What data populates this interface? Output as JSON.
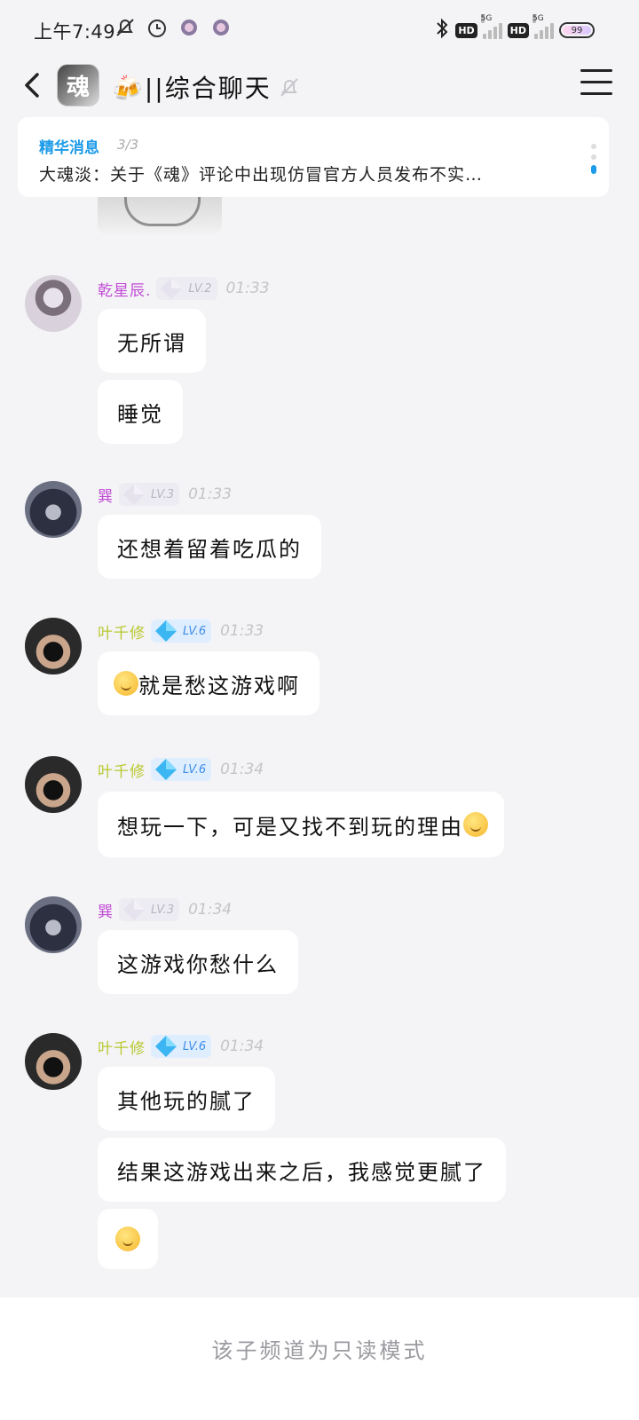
{
  "status_bar": {
    "time": "上午7:49",
    "network_type_1": "HD",
    "network_gen_1": "5G",
    "network_type_2": "HD",
    "network_gen_2": "5G",
    "battery": "99"
  },
  "header": {
    "channel_avatar_text": "魂",
    "title": "🍻||综合聊天"
  },
  "essence": {
    "label": "精华消息",
    "count": "3/3",
    "text": "大魂淡：关于《魂》评论中出现仿冒官方人员发布不实…"
  },
  "messages": [
    {
      "user": "乾星辰.",
      "level": "LV.2",
      "time": "01:33",
      "name_color": "#c14bd6",
      "bubbles": [
        "无所谓",
        "睡觉"
      ]
    },
    {
      "user": "巽",
      "level": "LV.3",
      "time": "01:33",
      "name_color": "#c14bd6",
      "bubbles": [
        "还想着留着吃瓜的"
      ]
    },
    {
      "user": "叶千修",
      "level": "LV.6",
      "time": "01:33",
      "name_color": "#b9c930",
      "bubbles": [
        "就是愁这游戏啊"
      ]
    },
    {
      "user": "叶千修",
      "level": "LV.6",
      "time": "01:34",
      "name_color": "#b9c930",
      "bubbles": [
        "想玩一下，可是又找不到玩的理由"
      ]
    },
    {
      "user": "巽",
      "level": "LV.3",
      "time": "01:34",
      "name_color": "#c14bd6",
      "bubbles": [
        "这游戏你愁什么"
      ]
    },
    {
      "user": "叶千修",
      "level": "LV.6",
      "time": "01:34",
      "name_color": "#b9c930",
      "bubbles": [
        "其他玩的腻了",
        "结果这游戏出来之后，我感觉更腻了"
      ]
    }
  ],
  "footer": {
    "readonly_text": "该子频道为只读模式"
  },
  "colors": {
    "accent": "#1c9be8",
    "background": "#f4f4f6",
    "bubble": "#ffffff"
  }
}
